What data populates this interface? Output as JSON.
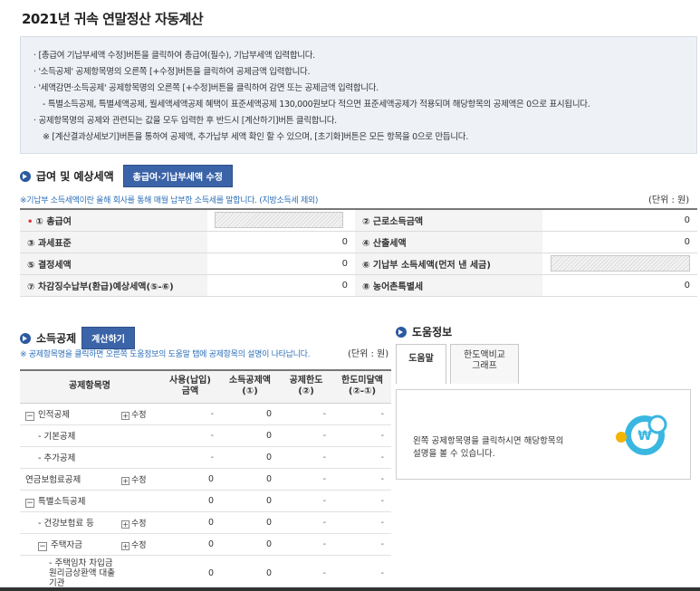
{
  "page_title": "2021년 귀속 연말정산 자동계산",
  "info": {
    "lines": [
      "· [총급여 기납부세액 수정]버튼을 클릭하여 총급여(필수), 기납부세액 입력합니다.",
      "· '소득공제' 공제항목명의 오른쪽 [+수정]버튼을 클릭하여 공제금액 입력합니다.",
      "· '세액감면·소득공제' 공제항목명의 오른쪽 [+수정]버튼을 클릭하여 감면 또는 공제금액 입력합니다.",
      "- 특별소득공제, 특별세액공제, 월세액세액공제 혜택이 표준세액공제 130,000원보다 적으면 표준세액공제가 적용되며 해당항목의 공제액은 0으로 표시됩니다.",
      "· 공제항목명의 공제와 관련되는 값을 모두 입력한 후 반드시 [계산하기]버튼 클릭합니다.",
      "※ [계산결과상세보기]버튼을 통하여 공제액, 추가납부 세액 확인 할 수 있으며, [초기화]버튼은 모든 항목을 0으로 만듭니다."
    ]
  },
  "salary_section": {
    "title": "급여 및 예상세액",
    "edit_button": "총급여·기납부세액 수정",
    "note": "※기납부 소득세액이란 올해 회사를 통해 매월 납부한 소득세를 말합니다. (지방소득세 제외)",
    "unit": "(단위 : 원)",
    "rows": [
      {
        "l_label": "① 총급여",
        "l_value": "",
        "r_label": "② 근로소득금액",
        "r_value": "0"
      },
      {
        "l_label": "③ 과세표준",
        "l_value": "0",
        "r_label": "④ 산출세액",
        "r_value": "0"
      },
      {
        "l_label": "⑤ 결정세액",
        "l_value": "0",
        "r_label": "⑥ 기납부 소득세액(먼저 낸 세금)",
        "r_value": ""
      },
      {
        "l_label": "⑦ 차감징수납부(환급)예상세액(⑤-⑥)",
        "l_value": "0",
        "r_label": "⑧ 농어촌특별세",
        "r_value": "0"
      }
    ]
  },
  "deduction_section": {
    "title": "소득공제",
    "calc_button": "계산하기",
    "note": "※ 공제항목명을 클릭하면 오른쪽 도움정보의 도움말 탭에 공제항목의 설명이 나타납니다.",
    "unit": "(단위 : 원)",
    "headers": [
      "공제항목명",
      "",
      "사용(납입)\n금액",
      "소득공제액\n(①)",
      "공제한도\n(②)",
      "한도미달액\n(②-①)"
    ],
    "rows": [
      {
        "name": "인적공제",
        "toggle": "−",
        "action": "수정",
        "used": "-",
        "deduct": "0",
        "limit": "-",
        "diff": "-",
        "level": 0
      },
      {
        "name": "- 기본공제",
        "toggle": "",
        "action": "",
        "used": "-",
        "deduct": "0",
        "limit": "-",
        "diff": "-",
        "level": 1
      },
      {
        "name": "- 추가공제",
        "toggle": "",
        "action": "",
        "used": "-",
        "deduct": "0",
        "limit": "-",
        "diff": "-",
        "level": 1
      },
      {
        "name": "연금보험료공제",
        "toggle": "",
        "action": "수정",
        "used": "0",
        "deduct": "0",
        "limit": "-",
        "diff": "-",
        "level": 0
      },
      {
        "name": "특별소득공제",
        "toggle": "−",
        "action": "",
        "used": "0",
        "deduct": "0",
        "limit": "-",
        "diff": "-",
        "level": 0
      },
      {
        "name": "- 건강보험료 등",
        "toggle": "",
        "action": "수정",
        "used": "0",
        "deduct": "0",
        "limit": "-",
        "diff": "-",
        "level": 1
      },
      {
        "name": "주택자금",
        "toggle": "−",
        "action": "수정",
        "used": "0",
        "deduct": "0",
        "limit": "-",
        "diff": "-",
        "level": 1
      },
      {
        "name": "- 주택임차 차입금 원리금상환액 대출기관",
        "toggle": "",
        "action": "",
        "used": "0",
        "deduct": "0",
        "limit": "-",
        "diff": "-",
        "level": 2
      }
    ]
  },
  "help_section": {
    "title": "도움정보",
    "tabs": [
      "도움말",
      "한도액비교\n그래프"
    ],
    "text": "왼쪽 공제항목명을 클릭하시면 해당항목의\n설명을 볼 수 있습니다.",
    "illustration_symbol": "₩"
  },
  "colors": {
    "accent": "#3b64a8",
    "note": "#2c6fb8",
    "required": "#d33333"
  }
}
